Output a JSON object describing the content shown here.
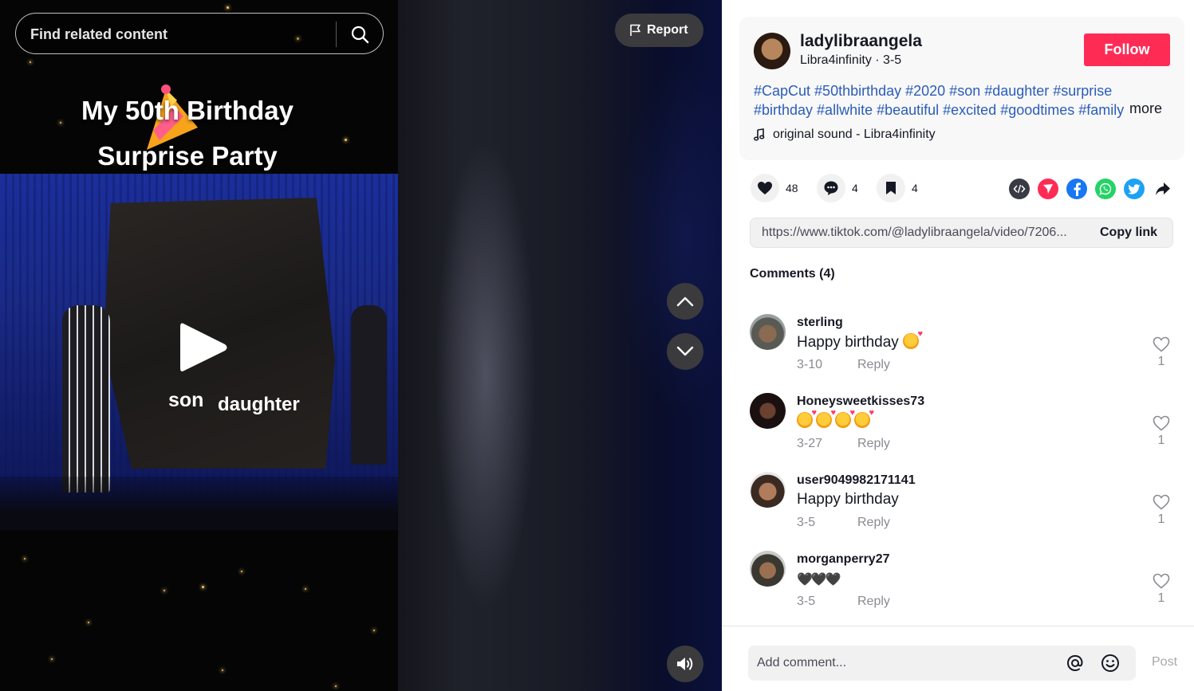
{
  "search": {
    "placeholder": "Find related content"
  },
  "video": {
    "title_line1": "My 50th Birthday",
    "title_line2": "Surprise Party",
    "label_son": "son",
    "label_daughter": "daughter"
  },
  "controls": {
    "report_label": "Report"
  },
  "author": {
    "username": "ladylibraangela",
    "nickname_date": "Libra4infinity · 3-5",
    "follow_label": "Follow"
  },
  "caption": {
    "line1": "#CapCut #50thbirthday #2020 #son #daughter #surprise",
    "line2": "#birthday #allwhite #beautiful #excited #goodtimes #family",
    "more_label": "more"
  },
  "music": {
    "label": "original sound - Libra4infinity"
  },
  "stats": {
    "likes": "48",
    "comments": "4",
    "saves": "4"
  },
  "share": {
    "link": "https://www.tiktok.com/@ladylibraangela/video/7206...",
    "copy_label": "Copy link"
  },
  "comments_header": "Comments (4)",
  "comments": [
    {
      "user": "sterling",
      "text": "Happy birthday",
      "emoji_count": 1,
      "date": "3-10",
      "reply": "Reply",
      "likes": "1"
    },
    {
      "user": "Honeysweetkisses73",
      "text": "",
      "emoji_count": 4,
      "date": "3-27",
      "reply": "Reply",
      "likes": "1"
    },
    {
      "user": "user9049982171141",
      "text": "Happy birthday",
      "emoji_count": 0,
      "date": "3-5",
      "reply": "Reply",
      "likes": "1"
    },
    {
      "user": "morganperry27",
      "text": "🖤🖤🖤",
      "emoji_count": 0,
      "date": "3-5",
      "reply": "Reply",
      "likes": "1"
    }
  ],
  "composer": {
    "placeholder": "Add comment...",
    "post_label": "Post"
  },
  "colors": {
    "accent": "#fe2c55",
    "hashtag": "#2b5db9",
    "muted": "#8a8b91"
  },
  "icons": [
    "search-icon",
    "flag-icon",
    "chevron-up-icon",
    "chevron-down-icon",
    "volume-icon",
    "play-icon",
    "music-note-icon",
    "heart-icon",
    "comment-icon",
    "bookmark-icon",
    "embed-icon",
    "send-icon",
    "facebook-icon",
    "whatsapp-icon",
    "twitter-icon",
    "share-arrow-icon",
    "at-icon",
    "emoji-icon"
  ]
}
